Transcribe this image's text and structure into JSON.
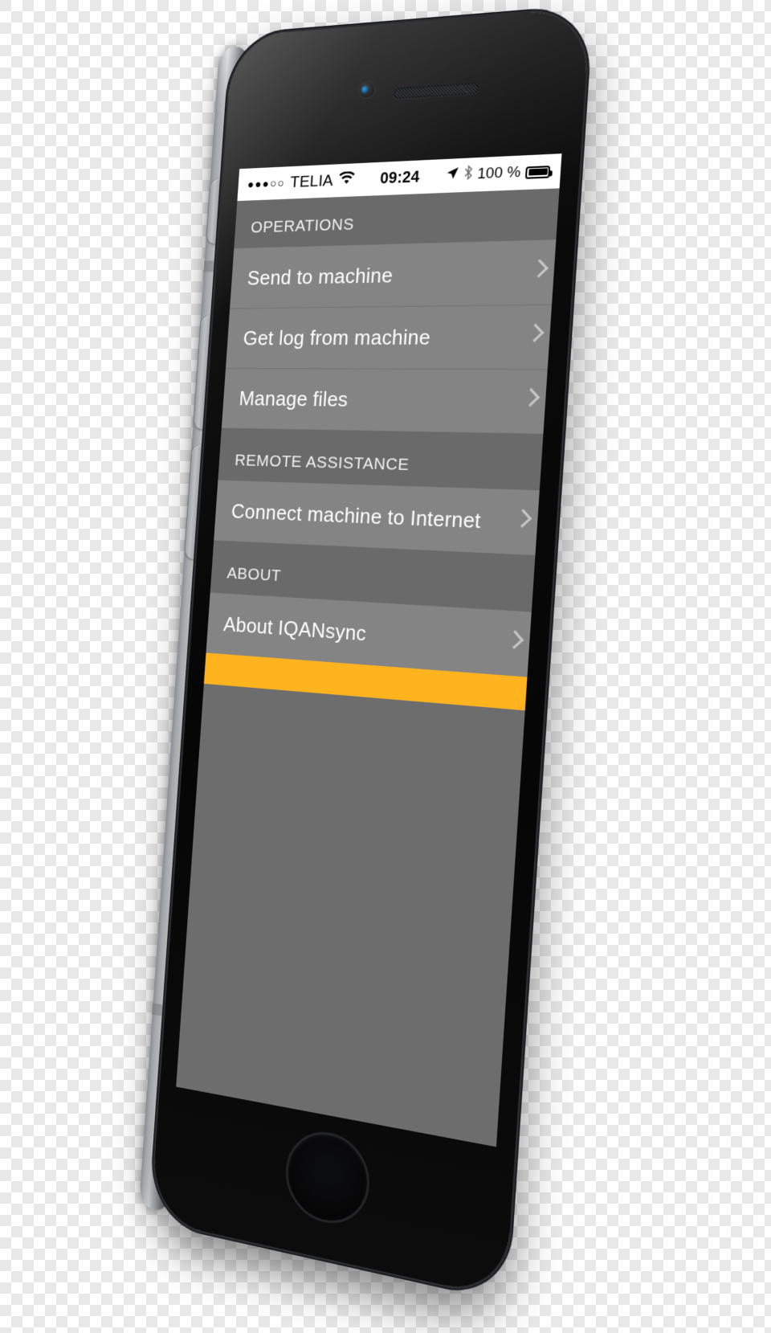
{
  "device": {
    "kind": "smartphone",
    "model_appearance": "space-gray-phone",
    "hardware": {
      "front_camera": "camera-icon",
      "earpiece": "speaker-grille-icon",
      "home_button": "home-button",
      "mute_switch": "mute-switch-button",
      "volume_up": "volume-up-button",
      "volume_down": "volume-down-button"
    }
  },
  "statusbar": {
    "signal_dots": "●●●○○",
    "carrier": "TELIA",
    "wifi_icon": "wifi-icon",
    "time": "09:24",
    "location_icon": "location-arrow-icon",
    "bluetooth_icon": "bluetooth-icon",
    "battery_percent": "100 %",
    "battery_icon": "battery-full-icon"
  },
  "app": {
    "name": "IQANsync",
    "accent_color": "#FFB41F",
    "screen_bg": "#6d6d6d",
    "row_bg": "#848484",
    "section_header_bg": "#6a6a6a",
    "text_color": "#ffffff"
  },
  "sections": [
    {
      "header": "OPERATIONS",
      "items": [
        {
          "label": "Send to machine",
          "accessory": "chevron-right-icon"
        },
        {
          "label": "Get log from machine",
          "accessory": "chevron-right-icon"
        },
        {
          "label": "Manage files",
          "accessory": "chevron-right-icon"
        }
      ]
    },
    {
      "header": "REMOTE ASSISTANCE",
      "items": [
        {
          "label": "Connect machine to Internet",
          "accessory": "chevron-right-icon"
        }
      ]
    },
    {
      "header": "ABOUT",
      "items": [
        {
          "label": "About IQANsync",
          "accessory": "chevron-right-icon"
        }
      ]
    }
  ]
}
